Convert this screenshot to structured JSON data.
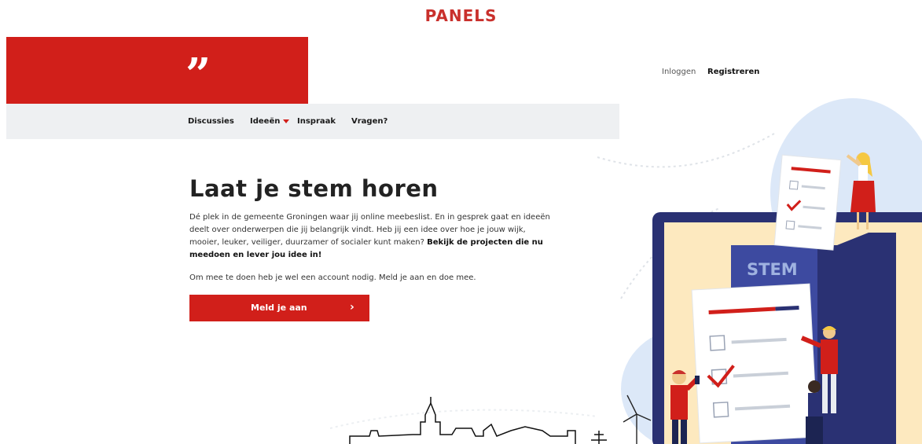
{
  "page_header": {
    "label": "PANELS"
  },
  "brand": {
    "logo_glyph": "”",
    "logo_color": "#d11f1a"
  },
  "auth": {
    "login_label": "Inloggen",
    "register_label": "Registreren"
  },
  "nav": {
    "items": [
      {
        "label": "Discussies"
      },
      {
        "label": "Ideeën",
        "has_dropdown": true
      },
      {
        "label": "Inspraak"
      },
      {
        "label": "Vragen?"
      }
    ]
  },
  "hero": {
    "title": "Laat je stem horen",
    "intro": "Dé plek in de gemeente Groningen waar jij online meebeslist. En in gesprek gaat en ideeën deelt over onderwerpen die jij belangrijk vindt. Heb jij een idee over hoe je jouw wijk, mooier, leuker, veiliger, duurzamer of socialer kunt maken?",
    "intro_bold": "Bekijk de projecten die nu meedoen en lever jou idee in!",
    "account_note": "Om mee te doen heb je wel een account nodig. Meld je aan en doe mee.",
    "cta_label": "Meld je aan",
    "cta_icon": "chevron-right-icon"
  },
  "illustration": {
    "ballot_box_label": "STEM"
  },
  "colors": {
    "accent": "#d11f1a",
    "nav_bg": "#eef0f2",
    "illus_bg": "#dce8f8",
    "screen_frame": "#2a3173"
  }
}
